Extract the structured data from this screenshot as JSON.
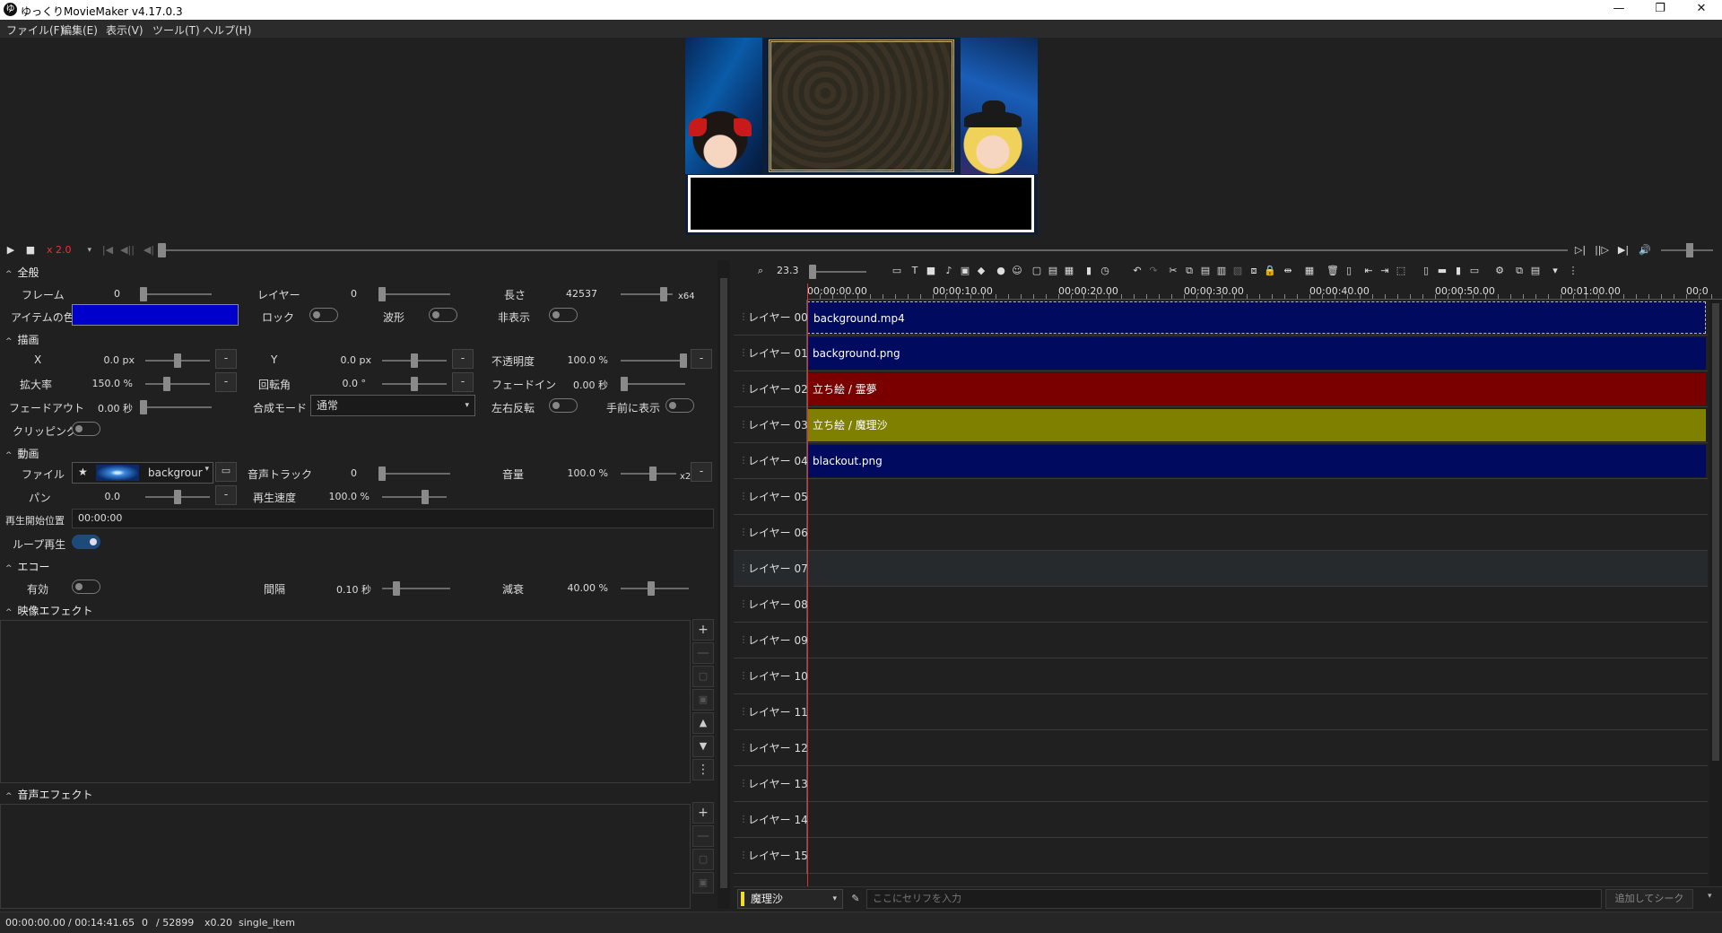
{
  "window": {
    "title": "ゆっくりMovieMaker v4.17.0.3",
    "app_icon": "ゆ",
    "minimize": "—",
    "restore": "❐",
    "close": "✕"
  },
  "menu": [
    "ファイル(F)",
    "編集(E)",
    "表示(V)",
    "ツール(T)",
    "ヘルプ(H)"
  ],
  "playback": {
    "play": "▶",
    "stop": "■",
    "speed": "x 2.0",
    "speed_dd": "▾",
    "prev_frame": "|◀",
    "prev_item": "◀||",
    "back": "◀|",
    "play_end": "▷|",
    "next_item": "||▷",
    "next_frame": "▶|",
    "volume": "🔊"
  },
  "props": {
    "general": {
      "header": "全般",
      "frame_label": "フレーム",
      "frame_value": "0",
      "layer_label": "レイヤー",
      "layer_value": "0",
      "length_label": "長さ",
      "length_value": "42537",
      "length_mult": "x64",
      "color_label": "アイテムの色",
      "color": "#0000cc",
      "lock_label": "ロック",
      "waveform_label": "波形",
      "hidden_label": "非表示"
    },
    "draw": {
      "header": "描画",
      "x_label": "X",
      "x_value": "0.0 px",
      "y_label": "Y",
      "y_value": "0.0 px",
      "opacity_label": "不透明度",
      "opacity_value": "100.0 %",
      "zoom_label": "拡大率",
      "zoom_value": "150.0 %",
      "rotation_label": "回転角",
      "rotation_value": "0.0 °",
      "fadein_label": "フェードイン",
      "fadein_value": "0.00 秒",
      "fadeout_label": "フェードアウト",
      "fadeout_value": "0.00 秒",
      "blend_label": "合成モード",
      "blend_value": "通常",
      "flip_label": "左右反転",
      "front_label": "手前に表示",
      "clipping_label": "クリッピング",
      "minus": "-"
    },
    "video": {
      "header": "動画",
      "file_label": "ファイル",
      "file_value": "backgrour",
      "audio_track_label": "音声トラック",
      "audio_track_value": "0",
      "volume_label": "音量",
      "volume_value": "100.0 %",
      "volume_mult": "x2",
      "pan_label": "パン",
      "pan_value": "0.0",
      "speed_label": "再生速度",
      "speed_value": "100.0 %",
      "start_label": "再生開始位置",
      "start_value": "00:00:00",
      "loop_label": "ループ再生"
    },
    "echo": {
      "header": "エコー",
      "enabled_label": "有効",
      "interval_label": "間隔",
      "interval_value": "0.10 秒",
      "decay_label": "減衰",
      "decay_value": "40.00 %"
    },
    "video_fx_header": "映像エフェクト",
    "audio_fx_header": "音声エフェクト",
    "fx_buttons": {
      "add": "+",
      "remove": "—",
      "copy": "▢",
      "save": "▣",
      "up": "▲",
      "down": "▼",
      "more": "⋮"
    }
  },
  "timeline": {
    "zoom_value": "23.3",
    "ruler": [
      "00:00:00.00",
      "00:00:10.00",
      "00:00:20.00",
      "00:00:30.00",
      "00:00:40.00",
      "00:00:50.00",
      "00:01:00.00",
      "00:0"
    ],
    "layers": [
      {
        "name": "レイヤー 00",
        "clip": "background.mp4",
        "color": "#000a5e"
      },
      {
        "name": "レイヤー 01",
        "clip": "background.png",
        "color": "#000a5e"
      },
      {
        "name": "レイヤー 02",
        "clip": "立ち絵 / 霊夢",
        "color": "#7a0000"
      },
      {
        "name": "レイヤー 03",
        "clip": "立ち絵 / 魔理沙",
        "color": "#7f7f00"
      },
      {
        "name": "レイヤー 04",
        "clip": "blackout.png",
        "color": "#000a5e"
      },
      {
        "name": "レイヤー 05"
      },
      {
        "name": "レイヤー 06"
      },
      {
        "name": "レイヤー 07"
      },
      {
        "name": "レイヤー 08"
      },
      {
        "name": "レイヤー 09"
      },
      {
        "name": "レイヤー 10"
      },
      {
        "name": "レイヤー 11"
      },
      {
        "name": "レイヤー 12"
      },
      {
        "name": "レイヤー 13"
      },
      {
        "name": "レイヤー 14"
      },
      {
        "name": "レイヤー 15"
      }
    ]
  },
  "serif": {
    "character": "魔理沙",
    "character_color": "#f0e020",
    "placeholder": "ここにセリフを入力",
    "seek_button": "追加してシーク"
  },
  "status": {
    "time": "00:00:00.00",
    "duration": "/ 00:14:41.65",
    "frame": "0",
    "total_frames": "/ 52899",
    "zoom": "x0.20",
    "mode": "single_item"
  }
}
